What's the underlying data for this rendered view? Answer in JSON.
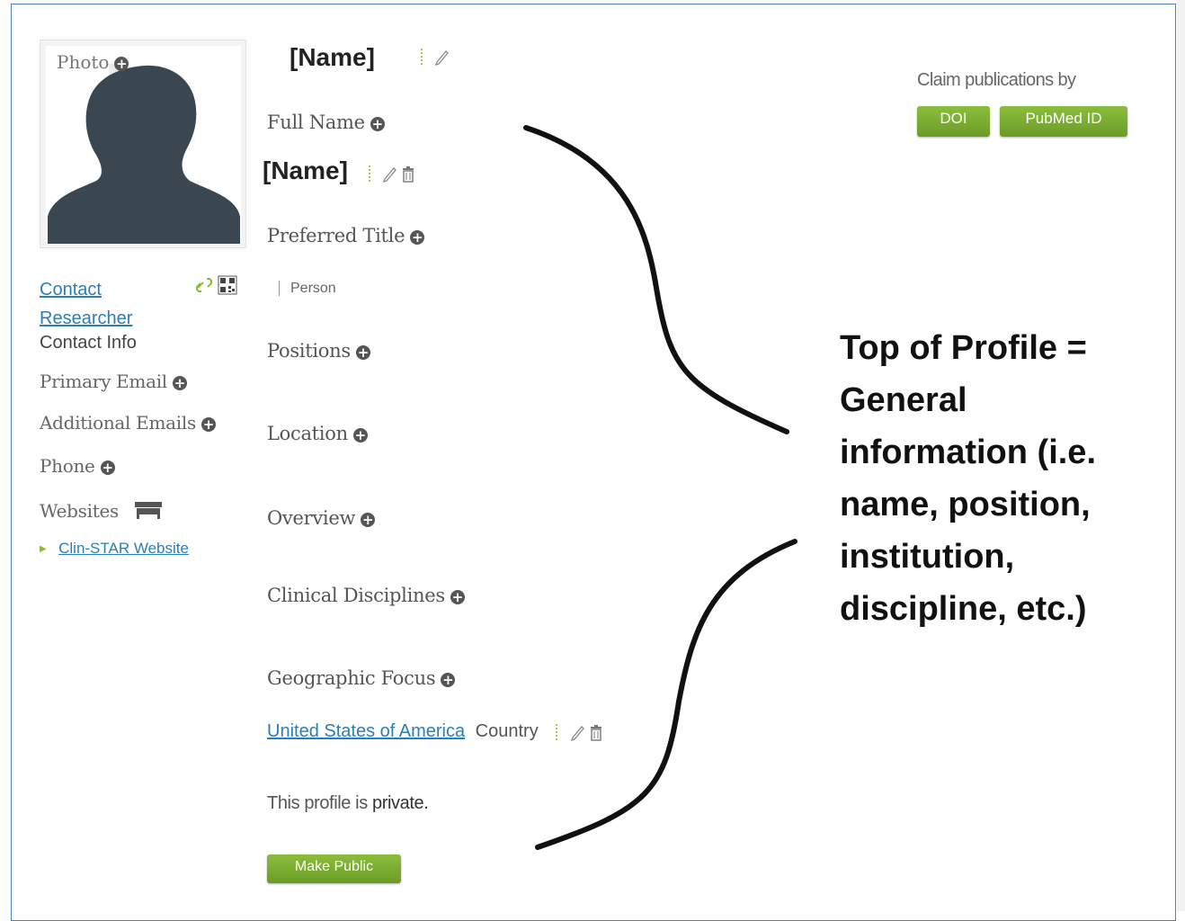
{
  "photo": {
    "label": "Photo"
  },
  "left_panel": {
    "contact_researcher": "Contact Researcher",
    "contact_info": "Contact Info",
    "primary_email": "Primary Email",
    "additional_emails": "Additional Emails",
    "phone": "Phone",
    "websites": "Websites",
    "website_link": "Clin-STAR Website"
  },
  "profile": {
    "name_heading": "[Name]",
    "full_name_label": "Full Name",
    "full_name_value": "[Name]",
    "preferred_title_label": "Preferred Title",
    "type_value": "Person",
    "positions_label": "Positions",
    "location_label": "Location",
    "overview_label": "Overview",
    "clinical_disciplines_label": "Clinical Disciplines",
    "geographic_focus_label": "Geographic Focus",
    "geo_link": "United States of America",
    "geo_type": "Country",
    "privacy_prefix": "This profile is ",
    "privacy_status": "private.",
    "make_public_button": "Make Public"
  },
  "claim": {
    "label": "Claim publications by",
    "doi_button": "DOI",
    "pubmed_button": "PubMed ID"
  },
  "annotation": {
    "text": "Top of Profile = General information (i.e. name, position, institution, discipline, etc.)"
  },
  "colors": {
    "green_button": "#7aab30",
    "link": "#2a7fb8",
    "border": "#4f81bd"
  },
  "icons": [
    "plus-circle-icon",
    "pencil-icon",
    "trash-icon",
    "link-icon",
    "qr-code-icon",
    "sofa-icon"
  ]
}
